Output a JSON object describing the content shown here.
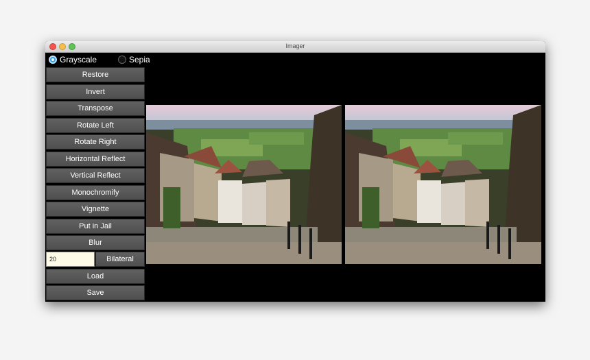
{
  "window": {
    "title": "Imager"
  },
  "filters": {
    "grayscale_label": "Grayscale",
    "sepia_label": "Sepia",
    "selected": "Grayscale"
  },
  "buttons": {
    "restore": "Restore",
    "invert": "Invert",
    "transpose": "Transpose",
    "rotate_left": "Rotate Left",
    "rotate_right": "Rotate Right",
    "horizontal_reflect": "Horizontal Reflect",
    "vertical_reflect": "Vertical Reflect",
    "monochromify": "Monochromify",
    "vignette": "Vignette",
    "put_in_jail": "Put in Jail",
    "blur": "Blur",
    "bilateral": "Bilateral",
    "load": "Load",
    "save": "Save"
  },
  "bilateral_input": {
    "value": "20"
  },
  "colors": {
    "radio_selected": "#2fa0e8",
    "button_bg": "#5a5a5a",
    "canvas_bg": "#000000",
    "input_bg": "#fdfbe8"
  },
  "icons": [
    "close-icon",
    "minimize-icon",
    "maximize-icon"
  ]
}
